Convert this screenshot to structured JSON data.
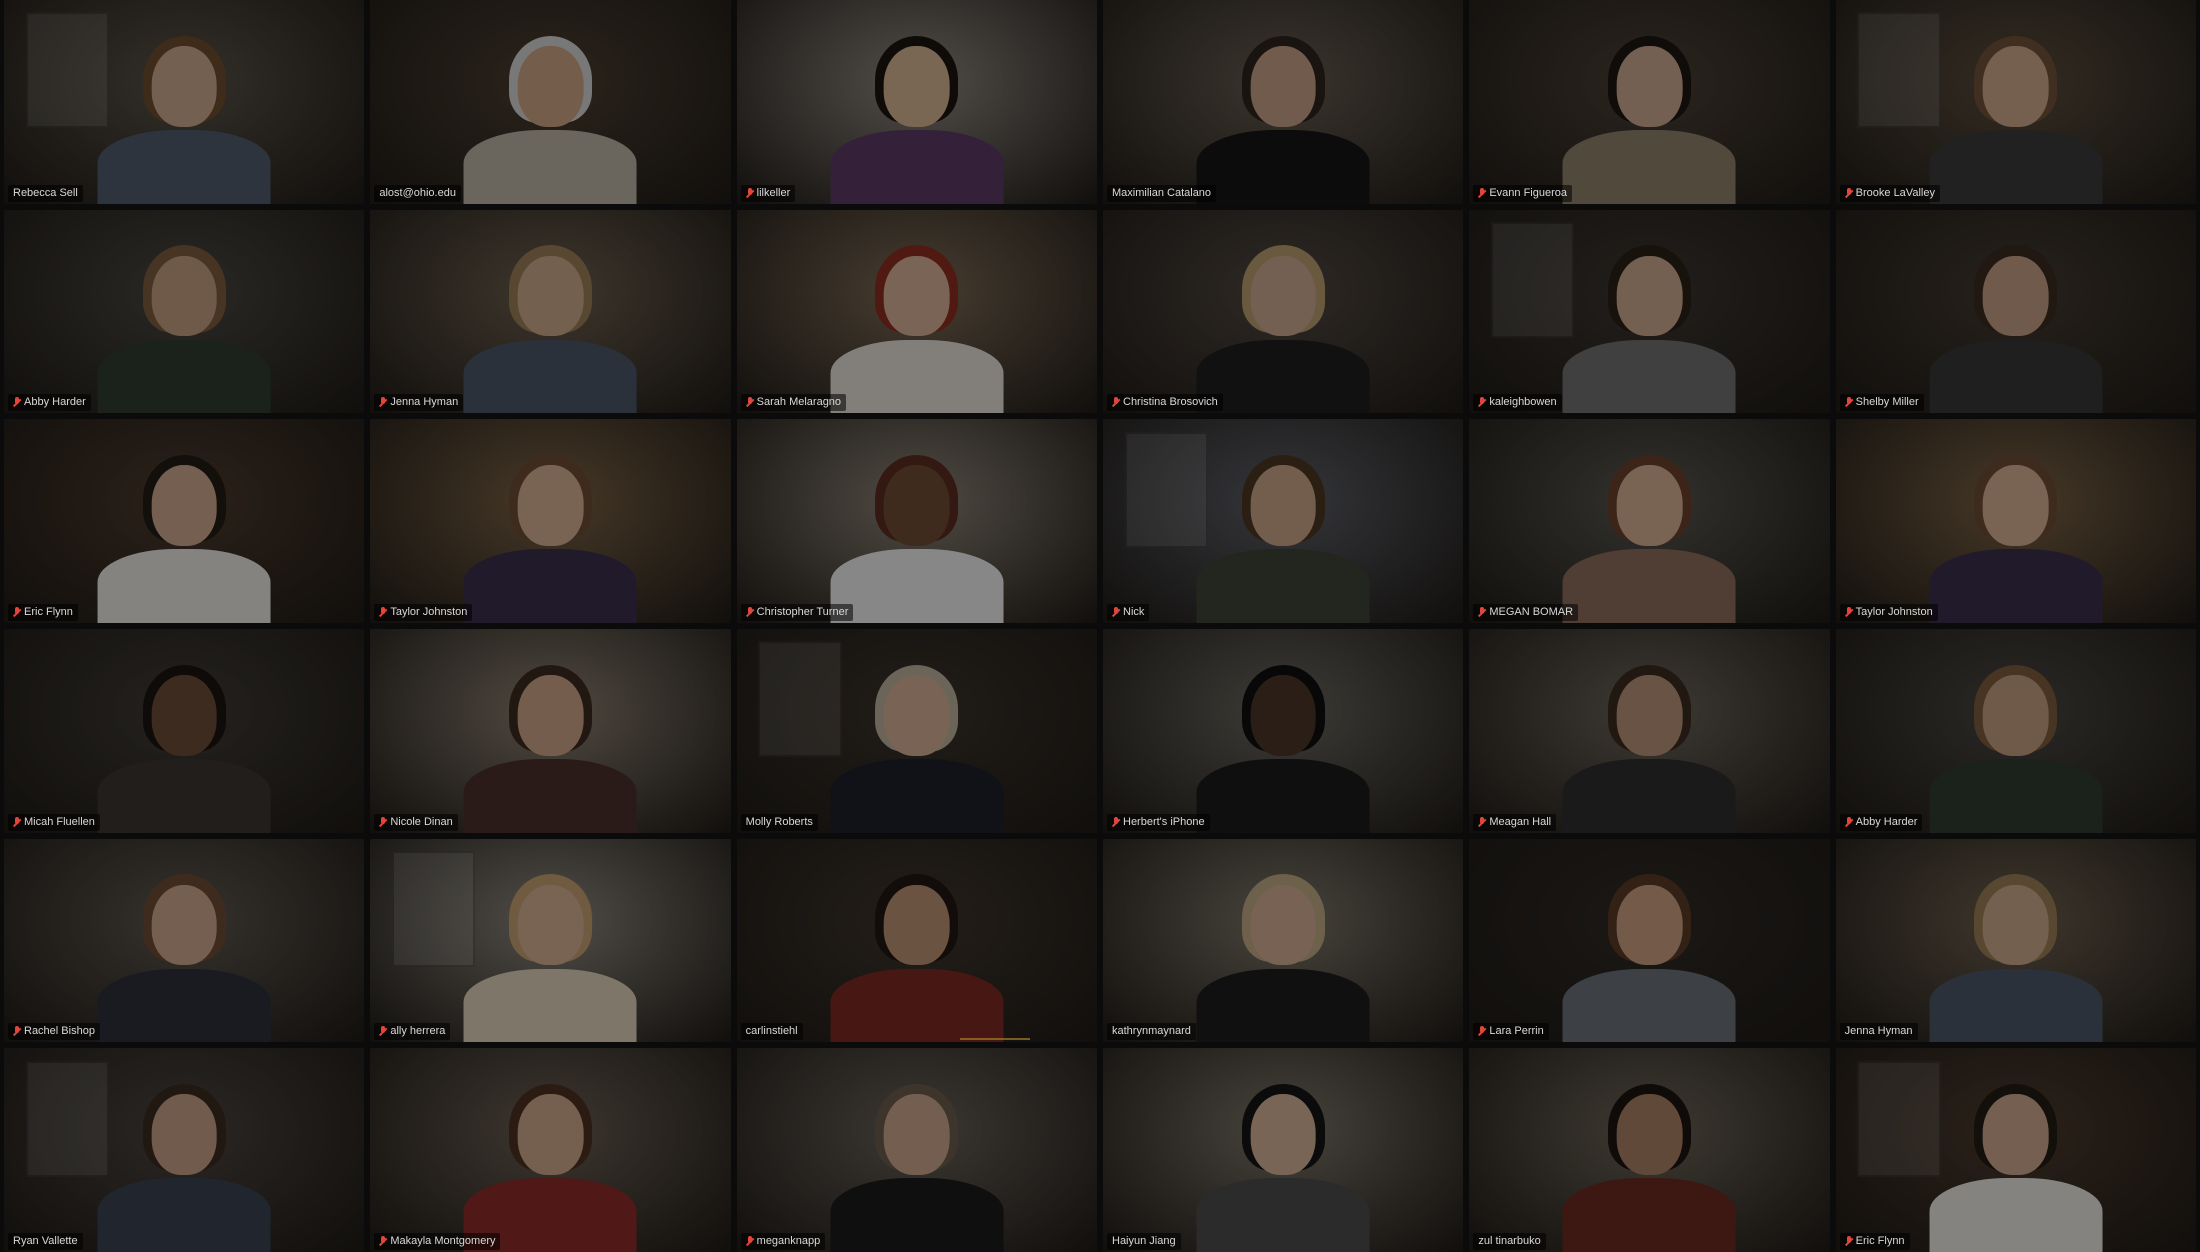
{
  "meeting": {
    "view": "gallery",
    "columns": 6,
    "rows": 6
  },
  "participants": [
    {
      "name": "Rebecca Sell",
      "muted": false,
      "wall": "#5a5348",
      "shirt": "#4f5a6a",
      "hair": "#6b4a2e",
      "skin": "#c9a58a"
    },
    {
      "name": "alost@ohio.edu",
      "muted": false,
      "active": true,
      "wall": "#4a3e30",
      "shirt": "#b7b0a0",
      "hair": "#cfcfcf",
      "skin": "#c9a080"
    },
    {
      "name": "lilkeller",
      "muted": true,
      "wall": "#8d8780",
      "shirt": "#5a3a63",
      "hair": "#1b1410",
      "skin": "#d3b190"
    },
    {
      "name": "Maximilian Catalano",
      "muted": false,
      "wall": "#675d50",
      "shirt": "#161616",
      "hair": "#2b241d",
      "skin": "#c19d84"
    },
    {
      "name": "Evann Figueroa",
      "muted": true,
      "wall": "#4b4036",
      "shirt": "#8e7f6a",
      "hair": "#1d1510",
      "skin": "#c9a68d"
    },
    {
      "name": "Brooke LaValley",
      "muted": true,
      "wall": "#5a4d3d",
      "shirt": "#3a3a3a",
      "hair": "#6f5238",
      "skin": "#caa489"
    },
    {
      "name": "Abby Harder",
      "muted": true,
      "wall": "#4a4742",
      "shirt": "#2f3b2f",
      "hair": "#7b5a3c",
      "skin": "#bf9a7f"
    },
    {
      "name": "Jenna Hyman",
      "muted": true,
      "wall": "#6c5f4e",
      "shirt": "#4a5566",
      "hair": "#9a7c55",
      "skin": "#c9a688"
    },
    {
      "name": "Sarah Melaragno",
      "muted": true,
      "wall": "#7c6a55",
      "shirt": "#e0dbd3",
      "hair": "#8a2c1e",
      "skin": "#d1ad93"
    },
    {
      "name": "Christina Brosovich",
      "muted": true,
      "wall": "#514841",
      "shirt": "#1e1e1e",
      "hair": "#b59a6d",
      "skin": "#c9a68d"
    },
    {
      "name": "kaleighbowen",
      "muted": true,
      "wall": "#3b3630",
      "shirt": "#6e6e6e",
      "hair": "#2a1f17",
      "skin": "#c7a58a"
    },
    {
      "name": "Shelby Miller",
      "muted": true,
      "wall": "#433a31",
      "shirt": "#363636",
      "hair": "#3a2a1f",
      "skin": "#bf9c82"
    },
    {
      "name": "Eric Flynn",
      "muted": true,
      "wall": "#4b3a2c",
      "shirt": "#e6e2dc",
      "hair": "#221a14",
      "skin": "#c9a48a"
    },
    {
      "name": "Taylor Johnston",
      "muted": true,
      "wall": "#7a6245",
      "shirt": "#3a2e4a",
      "hair": "#6b4b35",
      "skin": "#d0ab8e"
    },
    {
      "name": "Christopher Turner",
      "muted": true,
      "wall": "#8b8275",
      "shirt": "#e8e8e8",
      "hair": "#5a2c20",
      "skin": "#6b4a35"
    },
    {
      "name": "Nick",
      "muted": true,
      "wall": "#5c5e66",
      "shirt": "#3c4236",
      "hair": "#4a3422",
      "skin": "#c6a186"
    },
    {
      "name": "MEGAN BOMAR",
      "muted": true,
      "wall": "#57564f",
      "shirt": "#8a6c5c",
      "hair": "#6a3e2a",
      "skin": "#d1ac92"
    },
    {
      "name": "Taylor Johnston",
      "muted": true,
      "wall": "#7a6245",
      "shirt": "#3a2e4a",
      "hair": "#6b4b35",
      "skin": "#d0ab8e"
    },
    {
      "name": "Micah Fluellen",
      "muted": true,
      "wall": "#3f3b35",
      "shirt": "#3b3530",
      "hair": "#1a1410",
      "skin": "#6b4a36"
    },
    {
      "name": "Nicole Dinan",
      "muted": true,
      "wall": "#8a7f70",
      "shirt": "#4b2f2a",
      "hair": "#3a2a20",
      "skin": "#c9a185"
    },
    {
      "name": "Molly Roberts",
      "muted": false,
      "wall": "#3a322b",
      "shirt": "#1e1e2a",
      "hair": "#b9ae9a",
      "skin": "#d0ab92"
    },
    {
      "name": "Herbert's iPhone",
      "muted": true,
      "wall": "#6a675f",
      "shirt": "#1b1b1b",
      "hair": "#0f0f0f",
      "skin": "#4a3426"
    },
    {
      "name": "Meagan Hall",
      "muted": true,
      "wall": "#6b6459",
      "shirt": "#2d2d30",
      "hair": "#3b2a20",
      "skin": "#b38f77"
    },
    {
      "name": "Abby Harder",
      "muted": true,
      "wall": "#4a4742",
      "shirt": "#2f3b2f",
      "hair": "#7b5a3c",
      "skin": "#bf9a7f"
    },
    {
      "name": "Rachel Bishop",
      "muted": true,
      "wall": "#5e5850",
      "shirt": "#2c2f3a",
      "hair": "#6b4a33",
      "skin": "#c9a48a"
    },
    {
      "name": "ally herrera",
      "muted": true,
      "wall": "#8c877d",
      "shirt": "#d9cbb5",
      "hair": "#c29c6e",
      "skin": "#d1ad92"
    },
    {
      "name": "carlinstiehl",
      "muted": false,
      "wall": "#3e352d",
      "shirt": "#7a2a22",
      "hair": "#201812",
      "skin": "#b98f70"
    },
    {
      "name": "kathrynmaynard",
      "muted": false,
      "wall": "#7c7668",
      "shirt": "#1c1c1c",
      "hair": "#bda784",
      "skin": "#cfaa8f"
    },
    {
      "name": "Lara Perrin",
      "muted": true,
      "wall": "#2f2a26",
      "shirt": "#6a7078",
      "hair": "#5a3a26",
      "skin": "#c99e7f"
    },
    {
      "name": "Jenna Hyman",
      "muted": false,
      "wall": "#6c5f4e",
      "shirt": "#4a5566",
      "hair": "#9a7c55",
      "skin": "#c9a688"
    },
    {
      "name": "Ryan Vallette",
      "muted": false,
      "wall": "#4a4440",
      "shirt": "#3a4250",
      "hair": "#3a2a20",
      "skin": "#c29e84"
    },
    {
      "name": "Makayla Montgomery",
      "muted": true,
      "wall": "#6a5f52",
      "shirt": "#8a2a26",
      "hair": "#4a3022",
      "skin": "#caa589"
    },
    {
      "name": "meganknapp",
      "muted": true,
      "wall": "#68625a",
      "shirt": "#1b1b1b",
      "hair": "#6a5a4a",
      "skin": "#c7a38b"
    },
    {
      "name": "Haiyun Jiang",
      "muted": false,
      "wall": "#7b7569",
      "shirt": "#4a4a4a",
      "hair": "#141414",
      "skin": "#d0ae93"
    },
    {
      "name": "zul tinarbuko",
      "muted": false,
      "wall": "#6c6457",
      "shirt": "#6a2a22",
      "hair": "#1a1410",
      "skin": "#a77f62"
    },
    {
      "name": "Eric Flynn",
      "muted": true,
      "wall": "#4b3a2c",
      "shirt": "#e6e2dc",
      "hair": "#221a14",
      "skin": "#c9a48a"
    }
  ]
}
